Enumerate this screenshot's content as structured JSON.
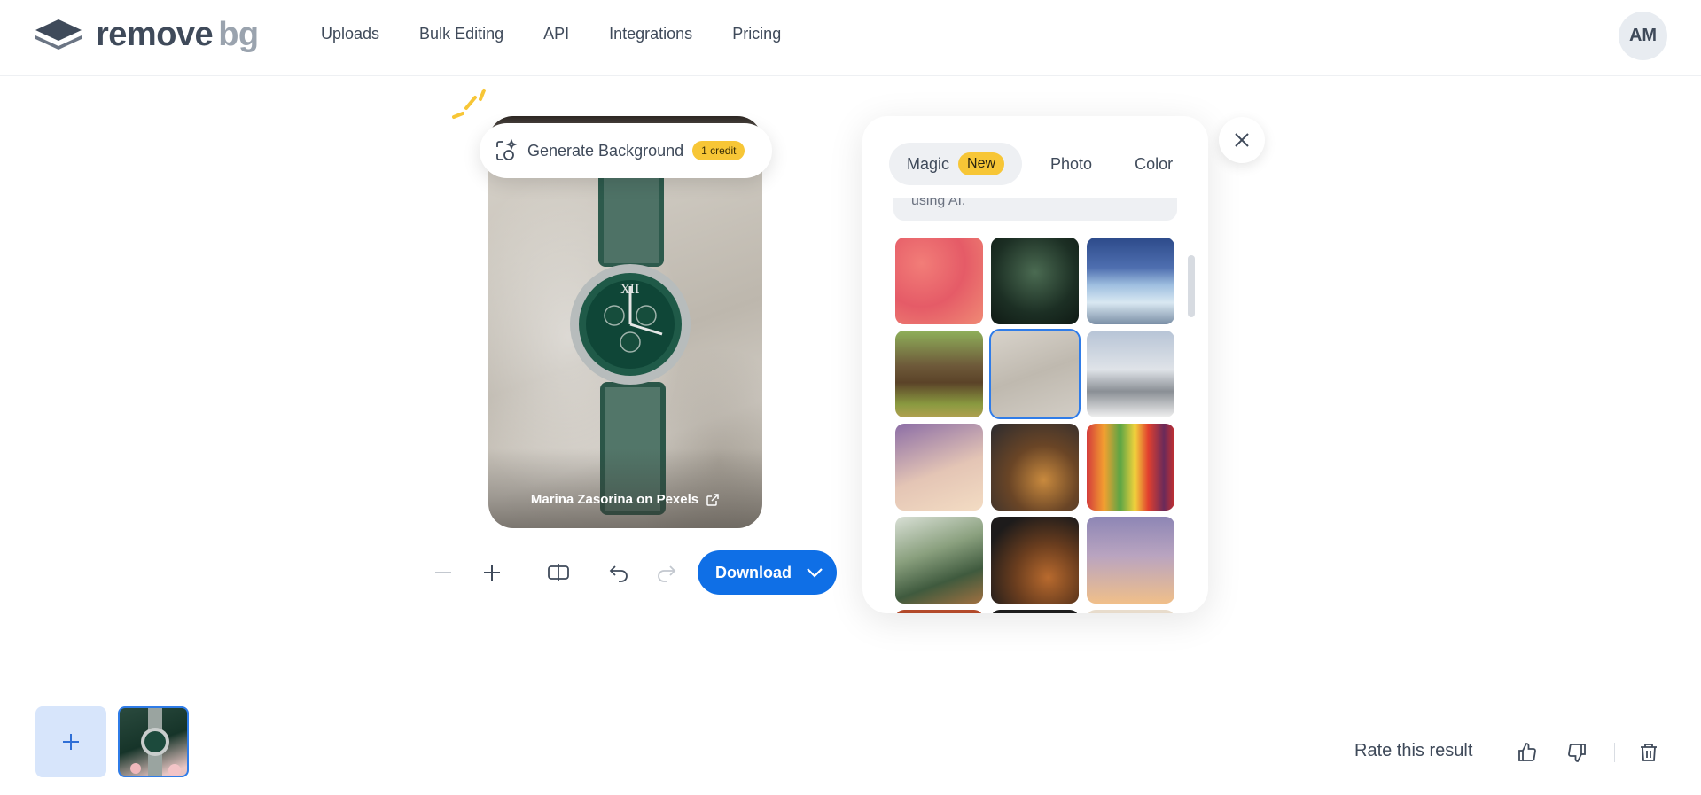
{
  "header": {
    "logo_text": "remove",
    "logo_suffix": "bg",
    "nav": [
      "Uploads",
      "Bulk Editing",
      "API",
      "Integrations",
      "Pricing"
    ],
    "avatar_initials": "AM"
  },
  "editor": {
    "generate_background_label": "Generate Background",
    "credit_badge": "1 credit",
    "photo_credit": "Marina Zasorina on Pexels",
    "download_label": "Download"
  },
  "panel": {
    "tabs": {
      "magic": "Magic",
      "new_badge": "New",
      "photo": "Photo",
      "color": "Color"
    },
    "hint_text": "using AI."
  },
  "footer": {
    "rate_label": "Rate this result"
  },
  "colors": {
    "accent": "#0f6fe6",
    "badge": "#f7c636"
  }
}
